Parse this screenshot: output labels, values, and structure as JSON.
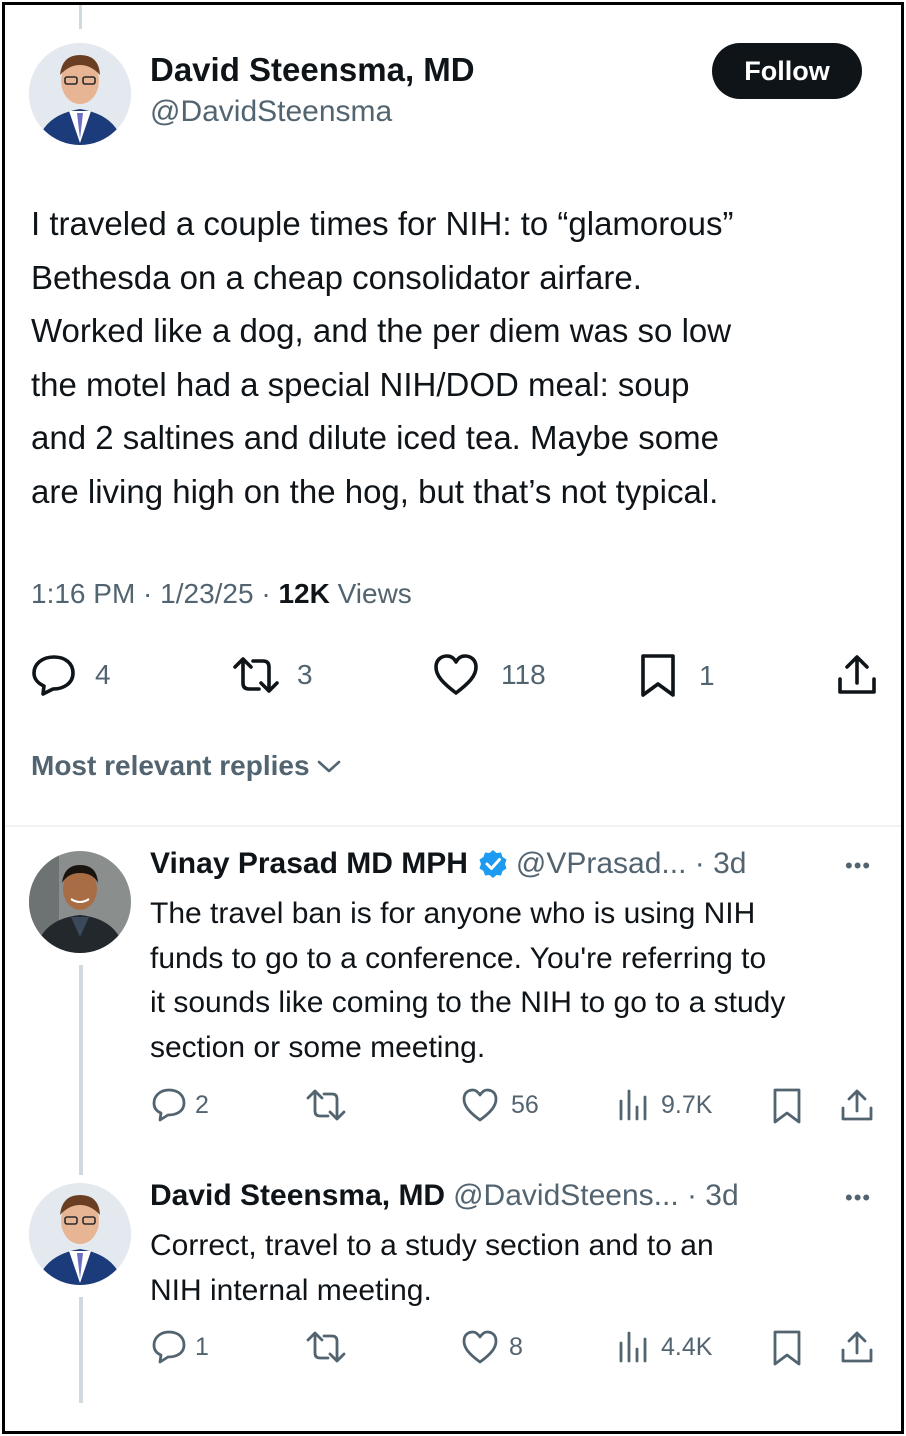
{
  "post": {
    "author_name": "David Steensma, MD",
    "author_handle": "@DavidSteensma",
    "follow_label": "Follow",
    "text_lines": [
      "I traveled a couple times for NIH: to “glamorous”",
      "Bethesda on a cheap consolidator airfare.",
      "Worked like a dog, and the per diem was so low",
      "the motel had a special NIH/DOD meal: soup",
      "and 2 saltines and dilute iced tea. Maybe some",
      "are living high on the hog, but that’s not typical."
    ],
    "time": "1:16 PM · 1/23/25 · ",
    "views_count": "12K",
    "views_label": " Views",
    "stats": {
      "replies": "4",
      "reposts": "3",
      "likes": "118",
      "bookmarks": "1"
    }
  },
  "replies_header": "Most relevant replies",
  "replies": [
    {
      "author_name": "Vinay Prasad MD MPH",
      "verified": true,
      "handle_time": "@VPrasad... · 3d",
      "text_lines": [
        "The travel ban is for anyone who is using NIH",
        "funds to go to a conference. You're referring to",
        "it sounds like coming to the NIH to go to a study",
        "section or some meeting."
      ],
      "stats": {
        "replies": "2",
        "reposts": "",
        "likes": "56",
        "views": "9.7K"
      }
    },
    {
      "author_name": "David Steensma, MD",
      "verified": false,
      "handle_time": "@DavidSteens... · 3d",
      "text_lines": [
        "Correct, travel to a study section and to an",
        "NIH internal meeting."
      ],
      "stats": {
        "replies": "1",
        "reposts": "",
        "likes": "8",
        "views": "4.4K"
      }
    }
  ],
  "icons": {
    "reply": "speech-bubble-icon",
    "repost": "repost-arrows-icon",
    "like": "heart-icon",
    "bookmark": "bookmark-icon",
    "share": "share-upload-icon",
    "views": "bar-chart-icon",
    "more": "more-dots-icon",
    "verified": "verified-badge-icon"
  },
  "colors": {
    "verified_badge": "#1d9bf0",
    "follow_button_bg": "#0f1419",
    "secondary_text": "#536471"
  }
}
